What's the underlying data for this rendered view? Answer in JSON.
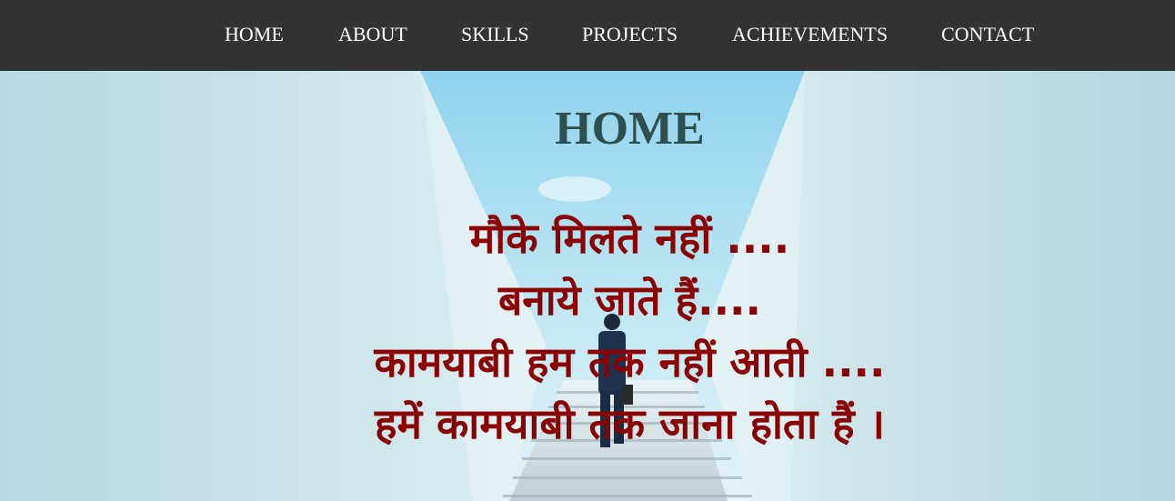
{
  "nav": {
    "items": [
      {
        "label": "HOME"
      },
      {
        "label": "ABOUT"
      },
      {
        "label": "SKILLS"
      },
      {
        "label": "PROJECTS"
      },
      {
        "label": "ACHIEVEMENTS"
      },
      {
        "label": "CONTACT"
      }
    ]
  },
  "hero": {
    "title": "HOME",
    "quote_lines": [
      "मौके मिलते नहीं ....",
      "बनाये जाते हैं....",
      "कामयाबी हम तक नहीं आती ....",
      "हमें कामयाबी तक जाना होता हैं ।"
    ]
  },
  "colors": {
    "navbar_bg": "#333333",
    "nav_text": "#ffffff",
    "title": "#2f4f4f",
    "quote": "#8b0000",
    "sky": "#a9def0",
    "wall": "#c9e6ee"
  },
  "background_image": {
    "description": "man-walking-up-stairs"
  }
}
